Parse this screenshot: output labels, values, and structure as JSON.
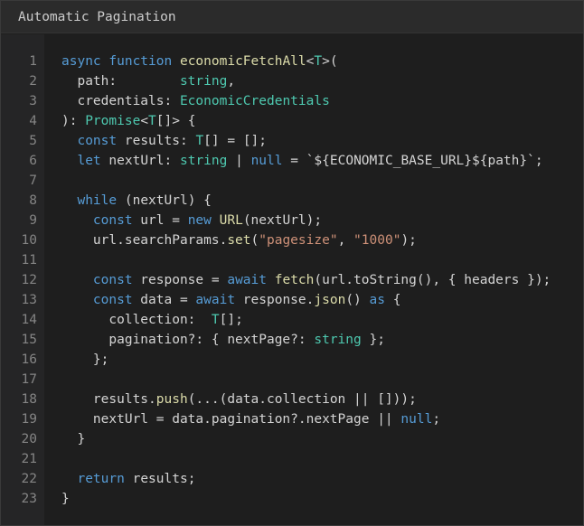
{
  "window": {
    "title": "Automatic Pagination"
  },
  "colors": {
    "keyword": "#569cd6",
    "function": "#dcdcaa",
    "type": "#4ec9b0",
    "string": "#ce9178",
    "plain": "#d4d4d4",
    "line_number": "#858585"
  },
  "code": {
    "lines": [
      {
        "number": "1",
        "tokens": [
          {
            "t": "async",
            "k": "kw"
          },
          {
            "t": " "
          },
          {
            "t": "function",
            "k": "kw"
          },
          {
            "t": " "
          },
          {
            "t": "economicFetchAll",
            "k": "fn"
          },
          {
            "t": "<"
          },
          {
            "t": "T",
            "k": "type"
          },
          {
            "t": ">("
          }
        ]
      },
      {
        "number": "2",
        "tokens": [
          {
            "t": "  path:        "
          },
          {
            "t": "string",
            "k": "type"
          },
          {
            "t": ","
          }
        ]
      },
      {
        "number": "3",
        "tokens": [
          {
            "t": "  credentials: "
          },
          {
            "t": "EconomicCredentials",
            "k": "type"
          }
        ]
      },
      {
        "number": "4",
        "tokens": [
          {
            "t": "): "
          },
          {
            "t": "Promise",
            "k": "type"
          },
          {
            "t": "<"
          },
          {
            "t": "T",
            "k": "type"
          },
          {
            "t": "[]> {"
          }
        ]
      },
      {
        "number": "5",
        "tokens": [
          {
            "t": "  "
          },
          {
            "t": "const",
            "k": "kw"
          },
          {
            "t": " results: "
          },
          {
            "t": "T",
            "k": "type"
          },
          {
            "t": "[] = [];"
          }
        ]
      },
      {
        "number": "6",
        "tokens": [
          {
            "t": "  "
          },
          {
            "t": "let",
            "k": "kw"
          },
          {
            "t": " nextUrl: "
          },
          {
            "t": "string",
            "k": "type"
          },
          {
            "t": " | "
          },
          {
            "t": "null",
            "k": "kw"
          },
          {
            "t": " = `${ECONOMIC_BASE_URL}${path}`;"
          }
        ]
      },
      {
        "number": "7",
        "tokens": [
          {
            "t": ""
          }
        ]
      },
      {
        "number": "8",
        "tokens": [
          {
            "t": "  "
          },
          {
            "t": "while",
            "k": "kw"
          },
          {
            "t": " (nextUrl) {"
          }
        ]
      },
      {
        "number": "9",
        "tokens": [
          {
            "t": "    "
          },
          {
            "t": "const",
            "k": "kw"
          },
          {
            "t": " url = "
          },
          {
            "t": "new",
            "k": "kw"
          },
          {
            "t": " "
          },
          {
            "t": "URL",
            "k": "fn"
          },
          {
            "t": "(nextUrl);"
          }
        ]
      },
      {
        "number": "10",
        "tokens": [
          {
            "t": "    url.searchParams."
          },
          {
            "t": "set",
            "k": "fn"
          },
          {
            "t": "("
          },
          {
            "t": "\"pagesize\"",
            "k": "str"
          },
          {
            "t": ", "
          },
          {
            "t": "\"1000\"",
            "k": "str"
          },
          {
            "t": ");"
          }
        ]
      },
      {
        "number": "11",
        "tokens": [
          {
            "t": ""
          }
        ]
      },
      {
        "number": "12",
        "tokens": [
          {
            "t": "    "
          },
          {
            "t": "const",
            "k": "kw"
          },
          {
            "t": " response = "
          },
          {
            "t": "await",
            "k": "kw"
          },
          {
            "t": " "
          },
          {
            "t": "fetch",
            "k": "fn"
          },
          {
            "t": "(url.toString(), { headers });"
          }
        ]
      },
      {
        "number": "13",
        "tokens": [
          {
            "t": "    "
          },
          {
            "t": "const",
            "k": "kw"
          },
          {
            "t": " data = "
          },
          {
            "t": "await",
            "k": "kw"
          },
          {
            "t": " response."
          },
          {
            "t": "json",
            "k": "fn"
          },
          {
            "t": "() "
          },
          {
            "t": "as",
            "k": "kw"
          },
          {
            "t": " {"
          }
        ]
      },
      {
        "number": "14",
        "tokens": [
          {
            "t": "      collection:  "
          },
          {
            "t": "T",
            "k": "type"
          },
          {
            "t": "[];"
          }
        ]
      },
      {
        "number": "15",
        "tokens": [
          {
            "t": "      pagination?: { nextPage?: "
          },
          {
            "t": "string",
            "k": "type"
          },
          {
            "t": " };"
          }
        ]
      },
      {
        "number": "16",
        "tokens": [
          {
            "t": "    };"
          }
        ]
      },
      {
        "number": "17",
        "tokens": [
          {
            "t": ""
          }
        ]
      },
      {
        "number": "18",
        "tokens": [
          {
            "t": "    results."
          },
          {
            "t": "push",
            "k": "fn"
          },
          {
            "t": "(...(data.collection || []));"
          }
        ]
      },
      {
        "number": "19",
        "tokens": [
          {
            "t": "    nextUrl = data.pagination?.nextPage || "
          },
          {
            "t": "null",
            "k": "kw"
          },
          {
            "t": ";"
          }
        ]
      },
      {
        "number": "20",
        "tokens": [
          {
            "t": "  }"
          }
        ]
      },
      {
        "number": "21",
        "tokens": [
          {
            "t": ""
          }
        ]
      },
      {
        "number": "22",
        "tokens": [
          {
            "t": "  "
          },
          {
            "t": "return",
            "k": "kw"
          },
          {
            "t": " results;"
          }
        ]
      },
      {
        "number": "23",
        "tokens": [
          {
            "t": "}"
          }
        ]
      }
    ]
  }
}
